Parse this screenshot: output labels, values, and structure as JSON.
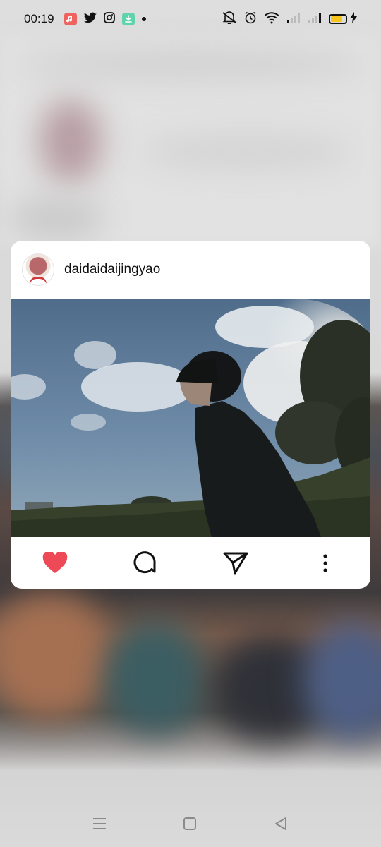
{
  "status_bar": {
    "time": "00:19",
    "notification_icons": [
      "music-app-icon",
      "twitter-icon",
      "instagram-icon",
      "download-app-icon",
      "dot-indicator"
    ],
    "system_icons": [
      "mute-icon",
      "alarm-icon",
      "wifi-icon",
      "signal-icon",
      "signal-icon",
      "battery-icon",
      "charging-icon"
    ]
  },
  "post": {
    "username": "daidaidaijingyao",
    "liked": true,
    "like_color": "#ed4956"
  },
  "actions": {
    "like_icon": "heart-icon",
    "comment_icon": "comment-icon",
    "share_icon": "send-icon",
    "more_icon": "more-vertical-icon"
  },
  "nav_bar": {
    "icons": [
      "menu-icon",
      "home-square-icon",
      "back-triangle-icon"
    ]
  }
}
